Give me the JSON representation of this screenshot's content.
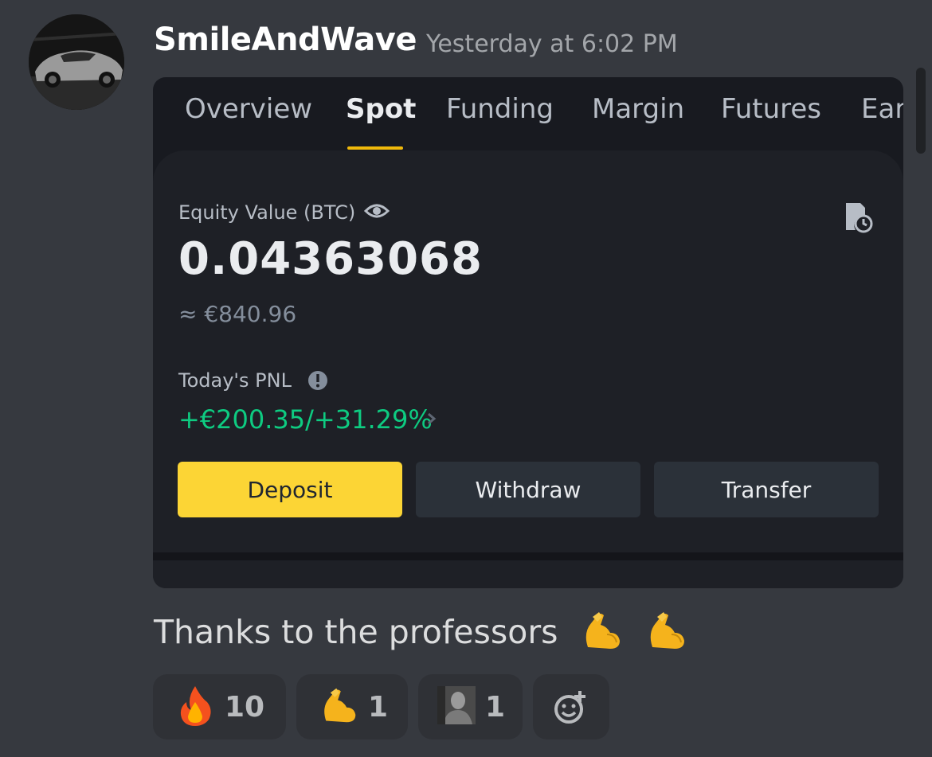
{
  "message": {
    "username": "SmileAndWave",
    "timestamp": "Yesterday at 6:02 PM",
    "text": "Thanks to the professors",
    "text_emojis": [
      "flexed-biceps",
      "flexed-biceps"
    ]
  },
  "screenshot": {
    "tabs": [
      {
        "label": "Overview",
        "active": false
      },
      {
        "label": "Spot",
        "active": true
      },
      {
        "label": "Funding",
        "active": false
      },
      {
        "label": "Margin",
        "active": false
      },
      {
        "label": "Futures",
        "active": false
      },
      {
        "label": "Ear",
        "active": false
      }
    ],
    "equity_label": "Equity Value (BTC)",
    "equity_value": "0.04363068",
    "equity_fiat": "≈ €840.96",
    "pnl_label": "Today's PNL",
    "pnl_value": "+€200.35/+31.29%",
    "buttons": {
      "deposit": "Deposit",
      "withdraw": "Withdraw",
      "transfer": "Transfer"
    },
    "colors": {
      "accent": "#f0b90b",
      "deposit_bg": "#fcd535",
      "pnl_positive": "#0ecb81"
    }
  },
  "reactions": [
    {
      "emoji": "fire",
      "count": "10"
    },
    {
      "emoji": "flexed-biceps",
      "count": "1"
    },
    {
      "emoji": "custom-portrait",
      "count": "1"
    }
  ],
  "add_reaction_icon": "add-reaction-icon"
}
